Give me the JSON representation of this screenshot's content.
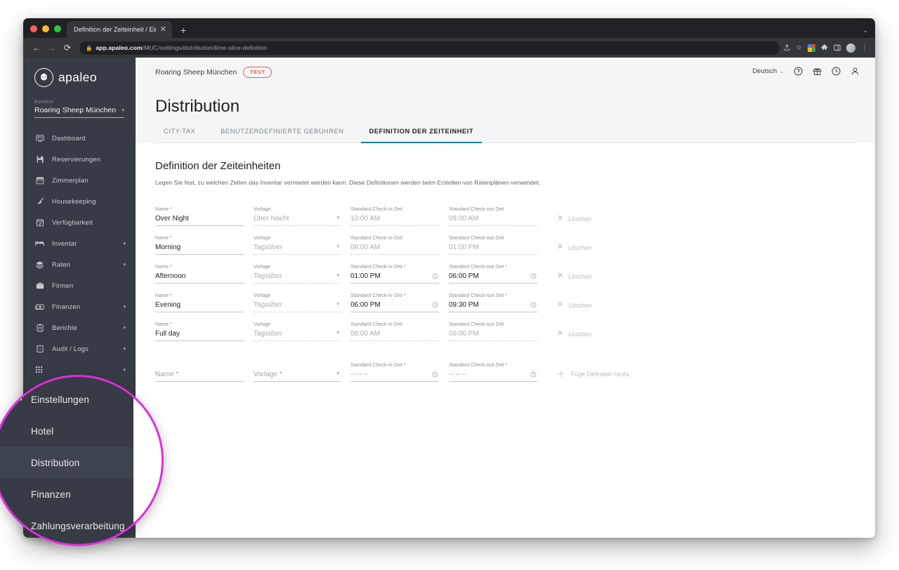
{
  "browser": {
    "tab_title": "Definition der Zeiteinheit / Ein",
    "tab_close_icon": "close-icon",
    "new_tab_icon": "plus-icon",
    "tab_overflow_icon": "chevron-down-icon",
    "back_icon": "arrow-left-icon",
    "forward_icon": "arrow-right-icon",
    "reload_icon": "reload-icon",
    "lock_icon": "lock-icon",
    "url_host": "app.apaleo.com",
    "url_path": "/MUC/settings/distribution/time-slice-definition",
    "toolbar_icons": [
      "share-icon",
      "star-icon",
      "extension-color-icon",
      "puzzle-icon",
      "sidepanel-icon",
      "profile-avatar-icon",
      "kebab-menu-icon"
    ]
  },
  "sidebar": {
    "brand": "apaleo",
    "logo_icon": "lion-logo-icon",
    "context_label": "Kontext",
    "context_value": "Roaring Sheep München",
    "context_caret_icon": "chevron-down-icon",
    "accent_underline": "#e8a33d",
    "background": "#363b45",
    "items": [
      {
        "label": "Dashboard",
        "icon": "monitor-icon",
        "expandable": false
      },
      {
        "label": "Reservierungen",
        "icon": "save-disk-icon",
        "expandable": false
      },
      {
        "label": "Zimmerplan",
        "icon": "calendar-icon",
        "expandable": false
      },
      {
        "label": "Housekeeping",
        "icon": "broom-icon",
        "expandable": false
      },
      {
        "label": "Verfügbarkeit",
        "icon": "calendar-check-icon",
        "expandable": false
      },
      {
        "label": "Inventar",
        "icon": "bed-icon",
        "expandable": true
      },
      {
        "label": "Raten",
        "icon": "layers-icon",
        "expandable": true
      },
      {
        "label": "Firmen",
        "icon": "briefcase-icon",
        "expandable": false
      },
      {
        "label": "Finanzen",
        "icon": "money-icon",
        "expandable": true
      },
      {
        "label": "Berichte",
        "icon": "clipboard-icon",
        "expandable": true
      },
      {
        "label": "Audit / Logs",
        "icon": "audit-icon",
        "expandable": true
      },
      {
        "label": "",
        "icon": "grid-apps-icon",
        "expandable": true
      }
    ]
  },
  "magnifier": {
    "border_color": "#e22ce0",
    "items": [
      {
        "label": "Einstellungen",
        "icon": "gear-icon",
        "selected": false,
        "is_header": true
      },
      {
        "label": "Hotel",
        "icon": "",
        "selected": false,
        "is_header": false
      },
      {
        "label": "Distribution",
        "icon": "",
        "selected": true,
        "is_header": false
      },
      {
        "label": "Finanzen",
        "icon": "",
        "selected": false,
        "is_header": false
      },
      {
        "label": "Zahlungsverarbeitung",
        "icon": "",
        "selected": false,
        "is_header": false
      }
    ]
  },
  "topbar": {
    "property_name": "Roaring Sheep München",
    "badge": "TEST",
    "badge_color": "#e1604f",
    "language": "Deutsch",
    "language_caret_icon": "chevron-down-icon",
    "icons": [
      "help-icon",
      "gift-icon",
      "clock-icon",
      "account-icon"
    ]
  },
  "page": {
    "title": "Distribution",
    "tabs": [
      {
        "label": "CITY-TAX",
        "active": false
      },
      {
        "label": "BENUTZERDEFINIERTE GEBÜHREN",
        "active": false
      },
      {
        "label": "DEFINITION DER ZEITEINHEIT",
        "active": true
      }
    ],
    "active_tab_color": "#1a7f8e"
  },
  "section": {
    "heading": "Definition der Zeiteinheiten",
    "description": "Legen Sie fest, zu welchen Zeiten das Inventar vermietet werden kann. Diese Definitionen werden beim Erstellen von Ratenplänen verwendet."
  },
  "labels": {
    "name": "Name *",
    "template": "Vorlage",
    "template_required": "Vorlage *",
    "checkin": "Standard Check-in-Zeit",
    "checkin_required": "Standard Check-in-Zeit *",
    "checkout": "Standard Check-out-Zeit",
    "checkout_required": "Standard Check-out-Zeit *",
    "delete": "Löschen",
    "delete_icon": "close-x-icon",
    "add": "Füge Definition hinzu",
    "add_icon": "plus-icon",
    "dropdown_icon": "chevron-down-icon",
    "time_icon": "clock-icon"
  },
  "rows": [
    {
      "name": "Over Night",
      "template": "Über Nacht",
      "checkin": "10:00 AM",
      "checkout": "09:00 AM",
      "checkin_label": "Standard Check-in-Zeit",
      "checkout_label": "Standard Check-out-Zeit",
      "times_editable": false
    },
    {
      "name": "Morning",
      "template": "Tagsüber",
      "checkin": "08:00 AM",
      "checkout": "01:00 PM",
      "checkin_label": "Standard Check-in-Zeit",
      "checkout_label": "Standard Check-out-Zeit",
      "times_editable": false
    },
    {
      "name": "Afternoon",
      "template": "Tagsüber",
      "checkin": "01:00 PM",
      "checkout": "06:00 PM",
      "checkin_label": "Standard Check-in-Zeit *",
      "checkout_label": "Standard Check-out-Zeit *",
      "times_editable": true
    },
    {
      "name": "Evening",
      "template": "Tagsüber",
      "checkin": "06:00 PM",
      "checkout": "09:30 PM",
      "checkin_label": "Standard Check-in-Zeit *",
      "checkout_label": "Standard Check-out-Zeit *",
      "times_editable": true
    },
    {
      "name": "Full day",
      "template": "Tagsüber",
      "checkin": "08:00 AM",
      "checkout": "06:00 PM",
      "checkin_label": "Standard Check-in-Zeit",
      "checkout_label": "Standard Check-out-Zeit",
      "times_editable": false
    }
  ],
  "new_row": {
    "name_placeholder": "Name *",
    "template_placeholder": "Vorlage *",
    "checkin_label": "Standard Check-in-Zeit *",
    "checkout_label": "Standard Check-out-Zeit *",
    "time_placeholder": "--:-- --"
  }
}
